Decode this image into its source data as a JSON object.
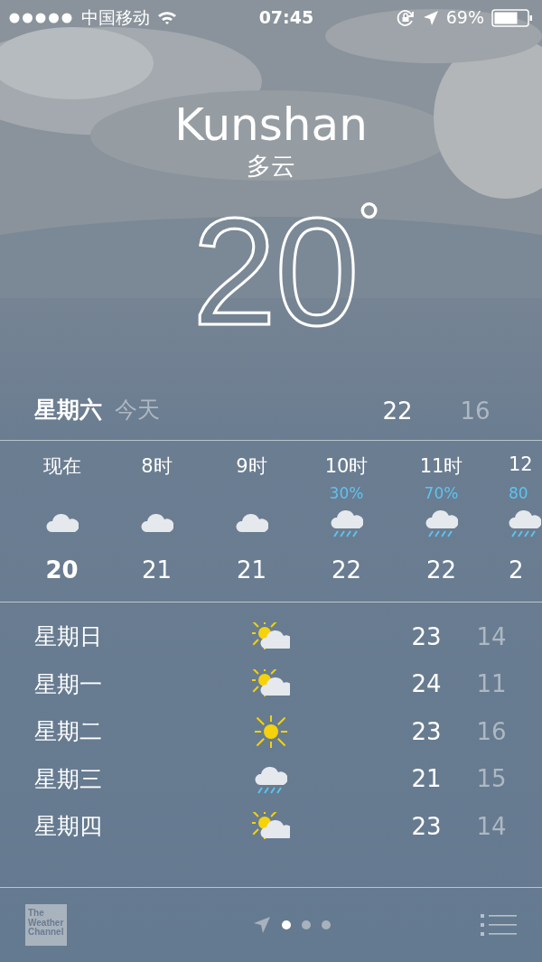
{
  "status_bar": {
    "carrier": "中国移动",
    "time": "07:45",
    "battery": "69%"
  },
  "location": {
    "city": "Kunshan",
    "condition": "多云",
    "temperature": "20",
    "degree": "°"
  },
  "today": {
    "day": "星期六",
    "label": "今天",
    "high": "22",
    "low": "16"
  },
  "hourly": [
    {
      "time": "现在",
      "kind": "cloudy",
      "temp": "20",
      "now": true
    },
    {
      "time": "8时",
      "kind": "cloudy",
      "temp": "21",
      "now": false
    },
    {
      "time": "9时",
      "kind": "cloudy",
      "temp": "21",
      "now": false
    },
    {
      "time": "10时",
      "chance": "30%",
      "kind": "rain",
      "temp": "22",
      "now": false
    },
    {
      "time": "11时",
      "chance": "70%",
      "kind": "rain",
      "temp": "22",
      "now": false
    },
    {
      "time": "12",
      "chance": "80",
      "kind": "rain",
      "temp": "2",
      "now": false
    }
  ],
  "daily": [
    {
      "day": "星期日",
      "kind": "partly_sunny",
      "high": "23",
      "low": "14"
    },
    {
      "day": "星期一",
      "kind": "partly_sunny",
      "high": "24",
      "low": "11"
    },
    {
      "day": "星期二",
      "kind": "sunny",
      "high": "23",
      "low": "16"
    },
    {
      "day": "星期三",
      "kind": "rain",
      "high": "21",
      "low": "15"
    },
    {
      "day": "星期四",
      "kind": "partly_sunny",
      "high": "23",
      "low": "14"
    }
  ],
  "footer": {
    "logo": "The Weather Channel",
    "pages": [
      {
        "kind": "location",
        "selected": false
      },
      {
        "kind": "dot",
        "selected": true
      },
      {
        "kind": "dot",
        "selected": false
      },
      {
        "kind": "dot",
        "selected": false
      }
    ]
  }
}
